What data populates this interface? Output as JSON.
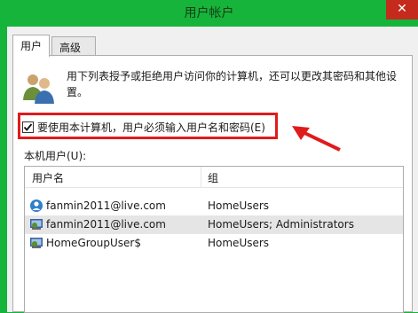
{
  "window": {
    "title": "用户帐户",
    "close_symbol": "✕"
  },
  "tabs": [
    {
      "label": "用户",
      "active": true
    },
    {
      "label": "高级",
      "active": false
    }
  ],
  "users_tab": {
    "description": "用下列表授予或拒绝用户访问你的计算机，还可以更改其密码和其他设置。",
    "require_login_checkbox": {
      "label": "要使用本计算机，用户必须输入用户名和密码(E)",
      "checked": true
    },
    "local_users_label": "本机用户(U):",
    "table": {
      "columns": [
        "用户名",
        "组"
      ],
      "rows": [
        {
          "name": "fanmin2011@live.com",
          "group": "HomeUsers",
          "icon": "online-user-icon",
          "selected": false
        },
        {
          "name": "fanmin2011@live.com",
          "group": "HomeUsers; Administrators",
          "icon": "admin-user-icon",
          "selected": true
        },
        {
          "name": "HomeGroupUser$",
          "group": "HomeUsers",
          "icon": "admin-user-icon",
          "selected": false
        }
      ]
    }
  },
  "annotation": {
    "highlight_color": "#e01b1b"
  },
  "colors": {
    "titlebar": "#16b43a",
    "close_button": "#c42b1c",
    "selected_row": "#e5e5e5"
  }
}
